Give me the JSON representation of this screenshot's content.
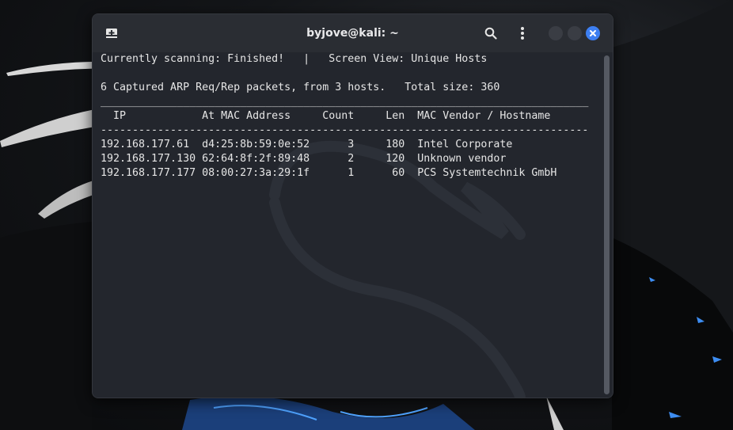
{
  "window": {
    "title": "byjove@kali: ~",
    "icons": {
      "new_tab": "new-tab-icon",
      "search": "search-icon",
      "menu": "kebab-menu-icon",
      "minimize": "minimize-icon",
      "maximize": "maximize-icon",
      "close": "close-icon"
    },
    "accent_color": "#3d7ff2"
  },
  "terminal": {
    "status_line": "Currently scanning: Finished!   |   Screen View: Unique Hosts",
    "summary_line": "6 Captured ARP Req/Rep packets, from 3 hosts.   Total size: 360",
    "separator": "_____________________________________________________________________________",
    "header_line": "  IP            At MAC Address     Count     Len  MAC Vendor / Hostname",
    "dash_separator": "-----------------------------------------------------------------------------",
    "columns": [
      "IP",
      "At MAC Address",
      "Count",
      "Len",
      "MAC Vendor / Hostname"
    ],
    "rows": [
      {
        "line": "192.168.177.61  d4:25:8b:59:0e:52      3     180  Intel Corporate",
        "ip": "192.168.177.61",
        "mac": "d4:25:8b:59:0e:52",
        "count": "3",
        "len": "180",
        "vendor": "Intel Corporate"
      },
      {
        "line": "192.168.177.130 62:64:8f:2f:89:48      2     120  Unknown vendor",
        "ip": "192.168.177.130",
        "mac": "62:64:8f:2f:89:48",
        "count": "2",
        "len": "120",
        "vendor": "Unknown vendor"
      },
      {
        "line": "192.168.177.177 08:00:27:3a:29:1f      1      60  PCS Systemtechnik GmbH",
        "ip": "192.168.177.177",
        "mac": "08:00:27:3a:29:1f",
        "count": "1",
        "len": "60",
        "vendor": "PCS Systemtechnik GmbH"
      }
    ],
    "text_color": "#e6e6e6",
    "background_color": "#23262d"
  }
}
